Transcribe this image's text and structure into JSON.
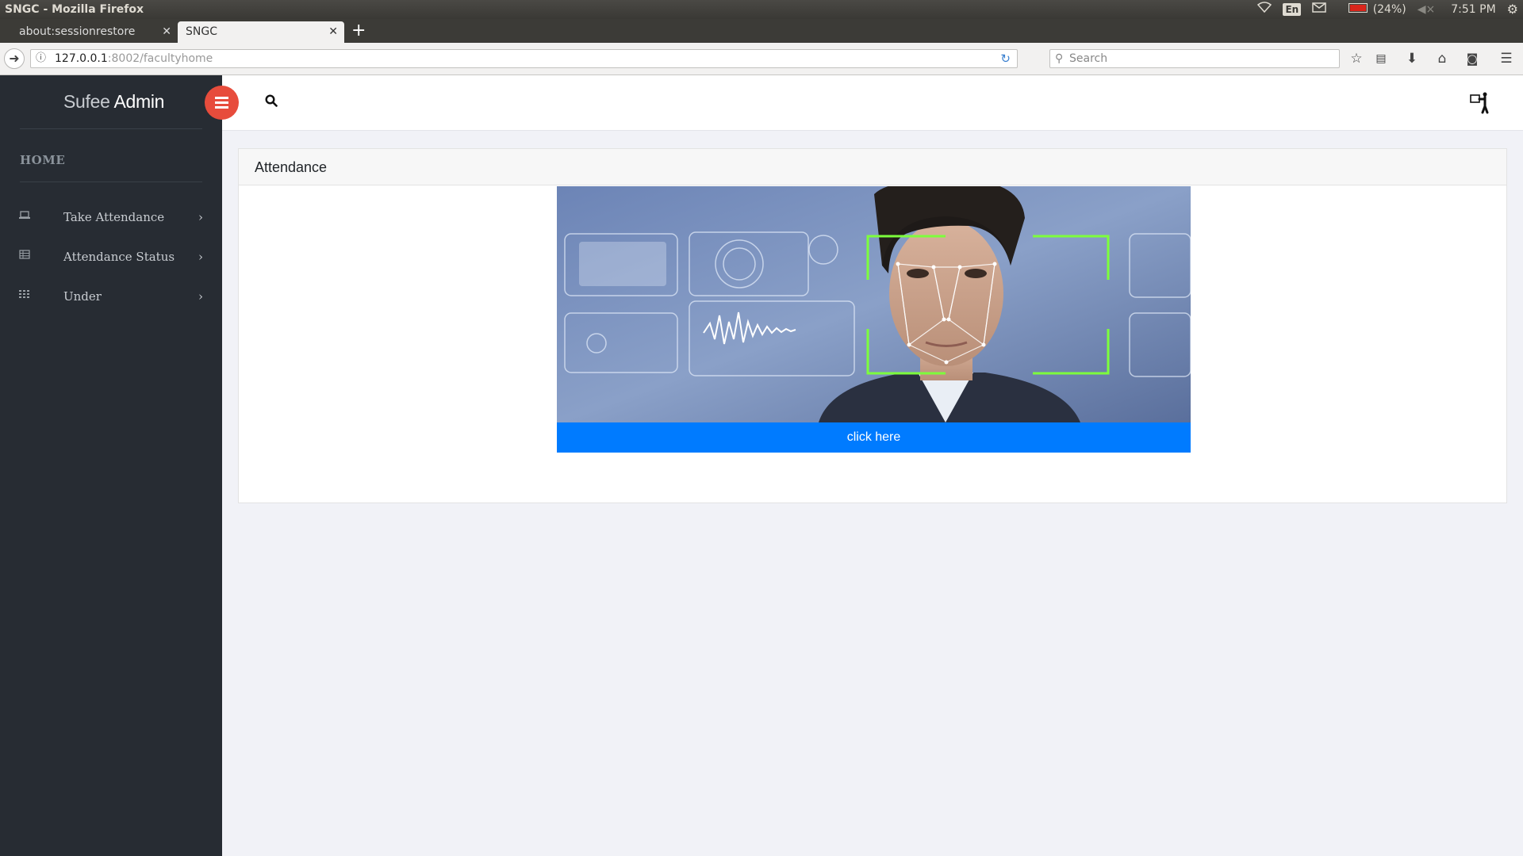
{
  "os": {
    "window_title": "SNGC - Mozilla Firefox",
    "keyboard": "En",
    "battery": "(24%)",
    "time": "7:51 PM"
  },
  "browser": {
    "tabs": [
      {
        "label": "about:sessionrestore",
        "active": false
      },
      {
        "label": "SNGC",
        "active": true
      }
    ],
    "url_host": "127.0.0.1",
    "url_rest": ":8002/facultyhome",
    "search_placeholder": "Search"
  },
  "sidebar": {
    "brand_light": "Sufee",
    "brand_bold": "Admin",
    "section_title": "HOME",
    "items": [
      {
        "label": "Take Attendance",
        "icon": "laptop-icon"
      },
      {
        "label": "Attendance Status",
        "icon": "table-icon"
      },
      {
        "label": "Under",
        "icon": "grid-icon"
      }
    ]
  },
  "card": {
    "title": "Attendance",
    "image_subject": "face-recognition",
    "button_label": "click here"
  },
  "colors": {
    "sidebar_bg": "#272c33",
    "toggle_red": "#e74c3c",
    "button_blue": "#007bff",
    "page_bg": "#f1f2f7"
  }
}
